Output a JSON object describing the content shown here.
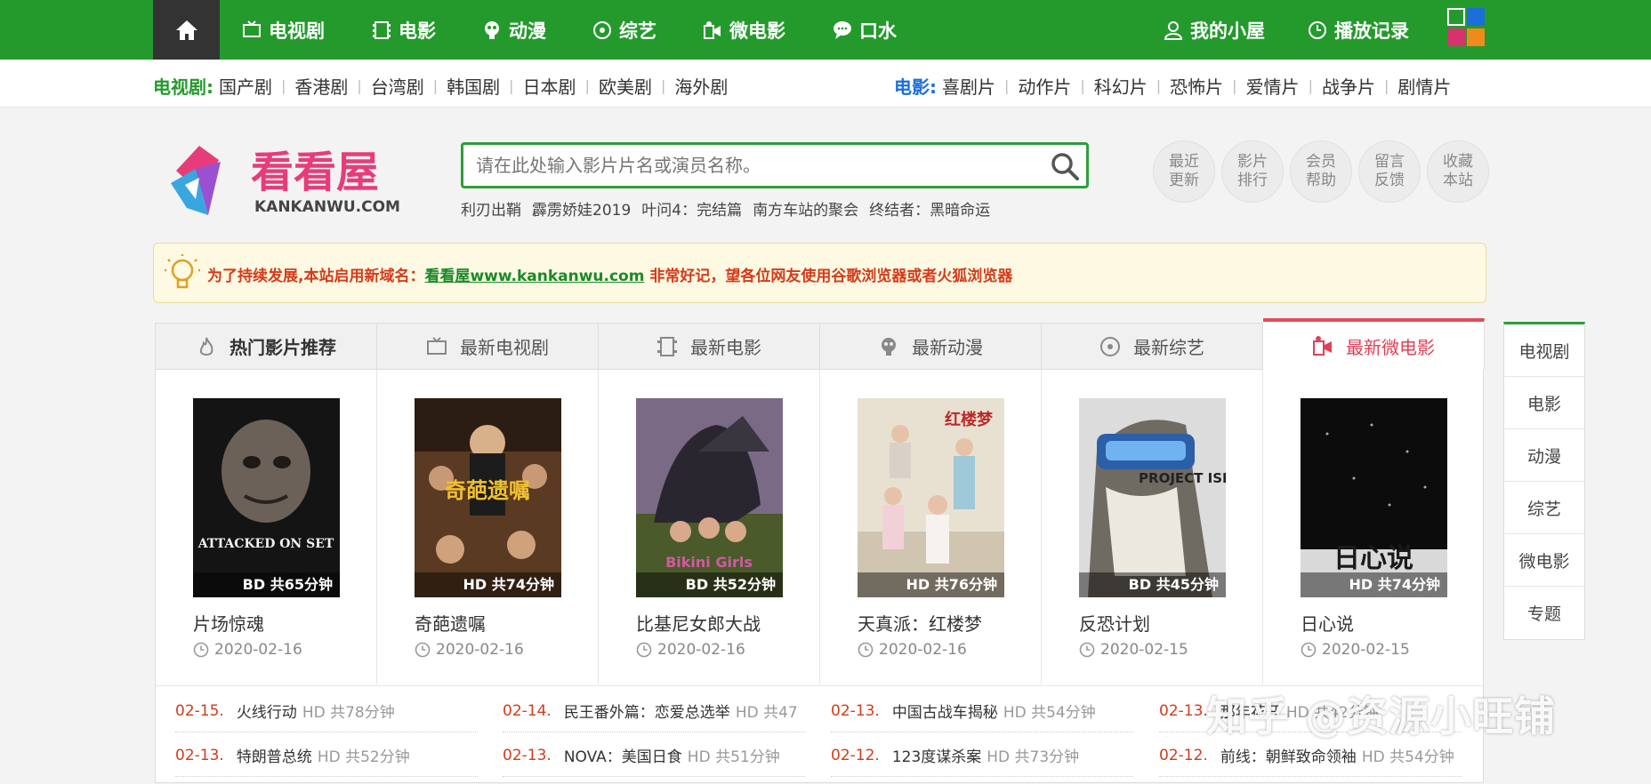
{
  "topnav": {
    "items": [
      {
        "label": "电视剧",
        "icon": "tv-icon"
      },
      {
        "label": "电影",
        "icon": "film-icon"
      },
      {
        "label": "动漫",
        "icon": "anime-icon"
      },
      {
        "label": "综艺",
        "icon": "variety-icon"
      },
      {
        "label": "微电影",
        "icon": "camera-icon"
      },
      {
        "label": "口水",
        "icon": "chat-icon"
      }
    ],
    "my_house": "我的小屋",
    "history": "播放记录"
  },
  "subnav": {
    "tv_title": "电视剧:",
    "tv_links": [
      "国产剧",
      "香港剧",
      "台湾剧",
      "韩国剧",
      "日本剧",
      "欧美剧",
      "海外剧"
    ],
    "movie_title": "电影:",
    "movie_links": [
      "喜剧片",
      "动作片",
      "科幻片",
      "恐怖片",
      "爱情片",
      "战争片",
      "剧情片"
    ]
  },
  "logo": {
    "name": "看看屋",
    "domain": "KANKANWU.COM"
  },
  "search": {
    "placeholder": "请在此处输入影片片名或演员名称。"
  },
  "hot_keywords": [
    "利刃出鞘",
    "霹雳娇娃2019",
    "叶问4：完结篇",
    "南方车站的聚会",
    "终结者：黑暗命运"
  ],
  "quick_links": [
    "最近更新",
    "影片排行",
    "会员帮助",
    "留言反馈",
    "收藏本站"
  ],
  "notice": {
    "prefix": "为了持续发展,本站启用新域名：",
    "link": "看看屋www.kankanwu.com",
    "suffix": " 非常好记，望各位网友使用谷歌浏览器或者火狐浏览器"
  },
  "tabs": [
    "热门影片推荐",
    "最新电视剧",
    "最新电影",
    "最新动漫",
    "最新综艺",
    "最新微电影"
  ],
  "movies": [
    {
      "title": "片场惊魂",
      "date": "2020-02-16",
      "badge": "BD 共65分钟",
      "poster_text": "ATTACKED ON SET"
    },
    {
      "title": "奇葩遗嘱",
      "date": "2020-02-16",
      "badge": "HD 共74分钟",
      "poster_text": "奇葩遗嘱"
    },
    {
      "title": "比基尼女郎大战",
      "date": "2020-02-16",
      "badge": "BD 共52分钟",
      "poster_text": "Bikini Girls"
    },
    {
      "title": "天真派：红楼梦",
      "date": "2020-02-16",
      "badge": "HD 共76分钟",
      "poster_text": "红楼梦"
    },
    {
      "title": "反恐计划",
      "date": "2020-02-15",
      "badge": "BD 共45分钟",
      "poster_text": "PROJECT ISISX"
    },
    {
      "title": "日心说",
      "date": "2020-02-15",
      "badge": "HD 共74分钟",
      "poster_text": "日心说"
    }
  ],
  "list_rows": [
    [
      {
        "date": "02-15.",
        "title": "火线行动",
        "quality": "HD 共78分钟"
      },
      {
        "date": "02-14.",
        "title": "民王番外篇：恋爱总选举",
        "quality": "HD 共47"
      },
      {
        "date": "02-13.",
        "title": "中国古战车揭秘",
        "quality": "HD 共54分钟"
      },
      {
        "date": "02-13.",
        "title": "那年花开",
        "quality": "HD 共42分钟"
      }
    ],
    [
      {
        "date": "02-13.",
        "title": "特朗普总统",
        "quality": "HD 共52分钟"
      },
      {
        "date": "02-13.",
        "title": "NOVA：美国日食",
        "quality": "HD 共51分钟"
      },
      {
        "date": "02-12.",
        "title": "123度谋杀案",
        "quality": "HD 共73分钟"
      },
      {
        "date": "02-12.",
        "title": "前线：朝鲜致命领袖",
        "quality": "HD 共54分钟"
      }
    ]
  ],
  "sidenav": [
    "电视剧",
    "电影",
    "动漫",
    "综艺",
    "微电影",
    "专题"
  ],
  "watermark": "知乎 @资源小旺铺",
  "colors": {
    "green": "#249a2d",
    "red": "#d43b1a",
    "pink": "#e04056"
  }
}
